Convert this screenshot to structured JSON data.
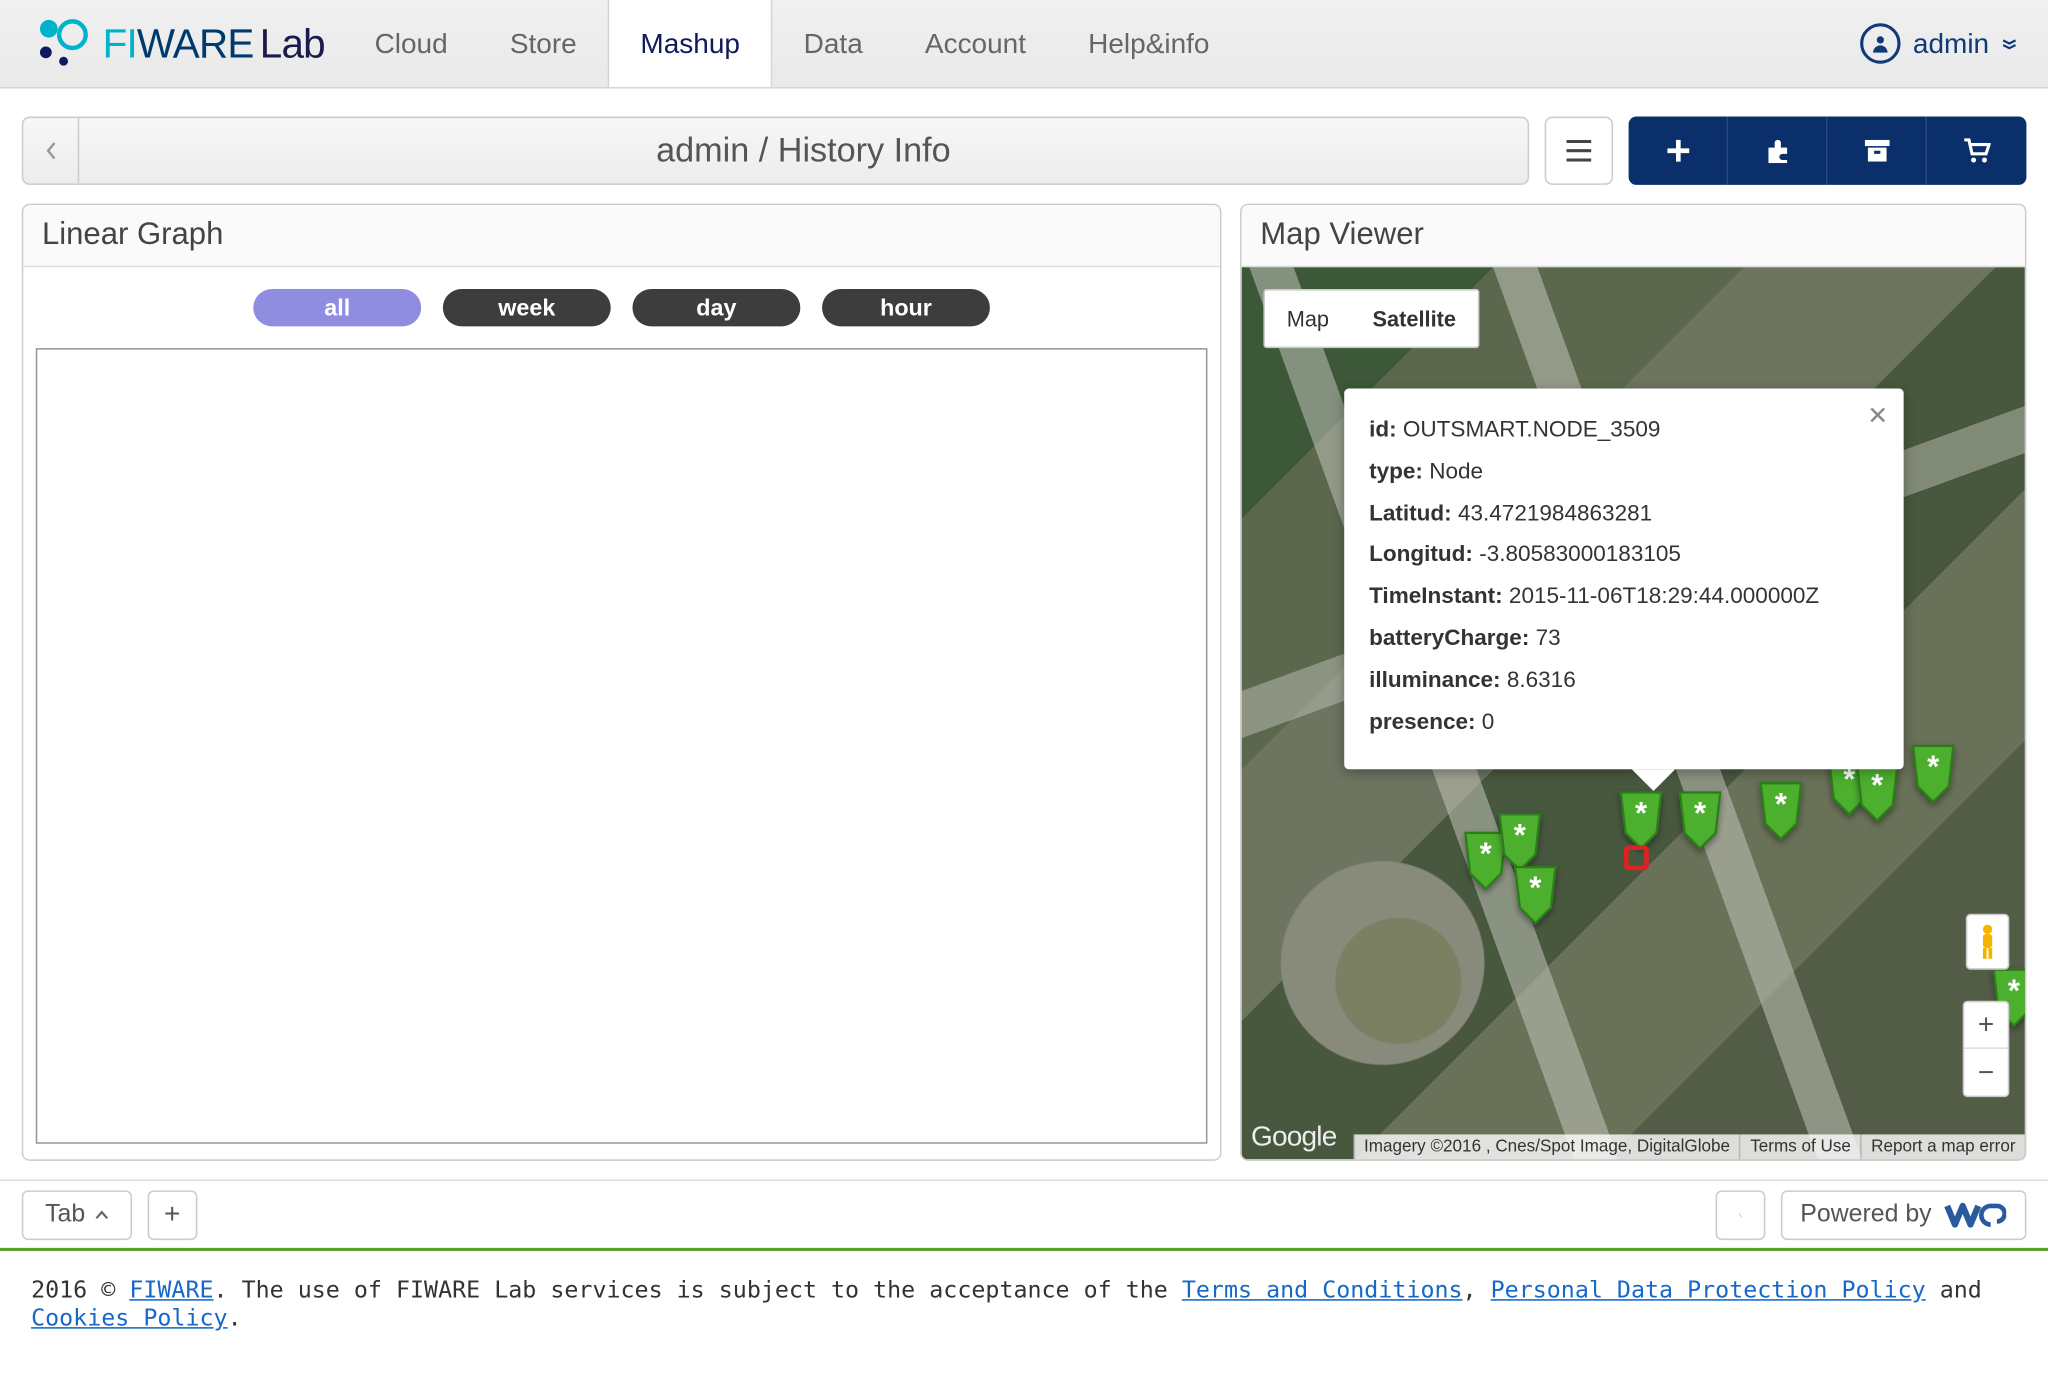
{
  "header": {
    "logo_fi": "FI",
    "logo_ware": "WARE",
    "logo_lab": "Lab",
    "nav": [
      "Cloud",
      "Store",
      "Mashup",
      "Data",
      "Account",
      "Help&info"
    ],
    "active_nav": 2,
    "user": "admin"
  },
  "breadcrumb": {
    "title": "admin / History Info"
  },
  "panels": {
    "linear_graph": {
      "title": "Linear Graph",
      "pills": [
        "all",
        "week",
        "day",
        "hour"
      ],
      "active_pill": 0
    },
    "map_viewer": {
      "title": "Map Viewer",
      "map_types": [
        "Map",
        "Satellite"
      ],
      "active_map_type": 1,
      "info": {
        "id_label": "id:",
        "id_value": "OUTSMART.NODE_3509",
        "type_label": "type:",
        "type_value": "Node",
        "lat_label": "Latitud:",
        "lat_value": "43.4721984863281",
        "lon_label": "Longitud:",
        "lon_value": "-3.80583000183105",
        "time_label": "TimeInstant:",
        "time_value": "2015-11-06T18:29:44.000000Z",
        "battery_label": "batteryCharge:",
        "battery_value": "73",
        "illum_label": "illuminance:",
        "illum_value": "8.6316",
        "presence_label": "presence:",
        "presence_value": "0"
      },
      "attrib": {
        "imagery": "Imagery ©2016 , Cnes/Spot Image, DigitalGlobe",
        "terms": "Terms of Use",
        "report": "Report a map error"
      },
      "google": "Google"
    }
  },
  "tabbar": {
    "tab_label": "Tab",
    "powered": "Powered by"
  },
  "legal": {
    "year": "2016 © ",
    "fiware": "FIWARE",
    "mid1": ". The use of FIWARE Lab services is subject to the acceptance of the ",
    "terms": "Terms and Conditions",
    "mid2": ", ",
    "privacy": "Personal Data Protection Policy",
    "mid3": " and ",
    "cookies": "Cookies Policy",
    "end": "."
  }
}
